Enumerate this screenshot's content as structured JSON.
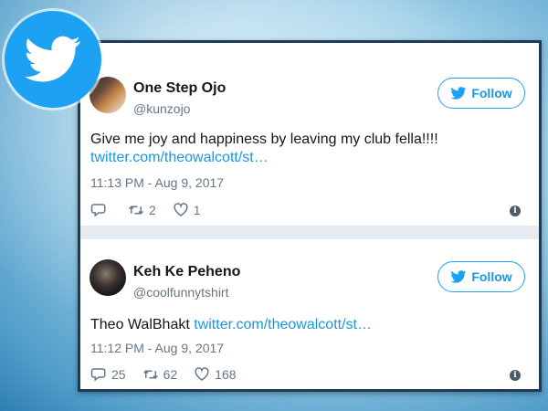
{
  "colors": {
    "twitter_blue": "#1da1f2",
    "link": "#1b95e0",
    "text": "#14171a",
    "muted": "#657786"
  },
  "icons": {
    "badge": "twitter-bird-icon",
    "reply": "reply-icon",
    "retweet": "retweet-icon",
    "like": "heart-icon",
    "info": "info-icon"
  },
  "tweets": [
    {
      "name": "One Step Ojo",
      "handle": "@kunzojo",
      "follow_label": "Follow",
      "text": "Give me joy and happiness by leaving my club fella!!!!",
      "link": "twitter.com/theowalcott/st…",
      "time": "11:13 PM - Aug 9, 2017",
      "reply_count": "",
      "retweet_count": "2",
      "like_count": "1",
      "info": "i"
    },
    {
      "name": "Keh Ke Peheno",
      "handle": "@coolfunnytshirt",
      "follow_label": "Follow",
      "text": "Theo WalBhakt",
      "link": "twitter.com/theowalcott/st…",
      "time": "11:12 PM - Aug 9, 2017",
      "reply_count": "25",
      "retweet_count": "62",
      "like_count": "168",
      "info": "i"
    }
  ]
}
